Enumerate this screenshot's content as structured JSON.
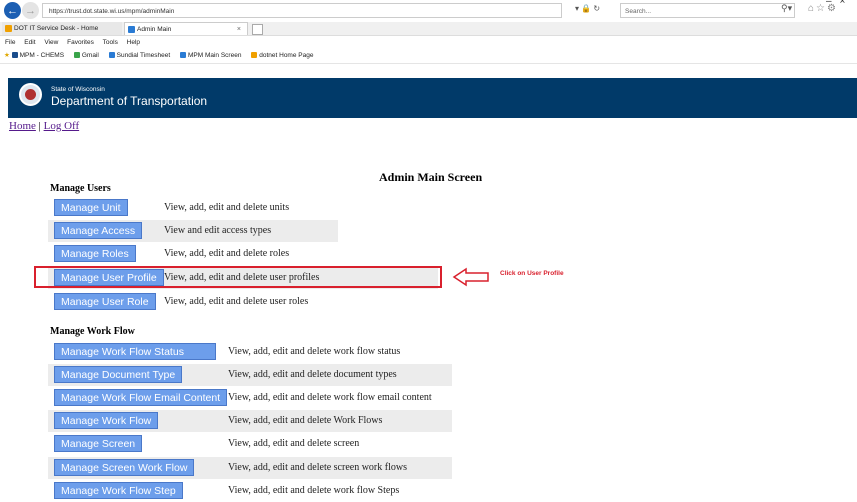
{
  "browser": {
    "url": "https://trust.dot.state.wi.us/mpm/adminMain",
    "search_placeholder": "Search...",
    "tabs": [
      {
        "label": "DOT IT Service Desk - Home"
      },
      {
        "label": "Admin Main"
      }
    ],
    "menu": [
      "File",
      "Edit",
      "View",
      "Favorites",
      "Tools",
      "Help"
    ],
    "favorites": [
      "MPM - CHEMS",
      "Gmail",
      "Sundial Timesheet",
      "MPM Main Screen",
      "dotnet Home Page"
    ]
  },
  "banner": {
    "line1": "State of Wisconsin",
    "line2": "Department of Transportation"
  },
  "nav": {
    "home": "Home",
    "separator": " | ",
    "logoff": "Log Off"
  },
  "page_title": "Admin Main Screen",
  "manage_users": {
    "heading": "Manage Users",
    "rows": [
      {
        "button": "Manage Unit",
        "desc": "View, add, edit and delete units"
      },
      {
        "button": "Manage Access",
        "desc": "View and edit access types"
      },
      {
        "button": "Manage Roles",
        "desc": "View, add, edit and delete roles"
      },
      {
        "button": "Manage User Profile",
        "desc": "View, add, edit and delete user profiles"
      },
      {
        "button": "Manage User Role",
        "desc": "View, add, edit and delete user roles"
      }
    ]
  },
  "manage_work_flow": {
    "heading": "Manage Work Flow",
    "rows": [
      {
        "button": "Manage Work Flow Status",
        "desc": "View, add, edit and delete work flow status"
      },
      {
        "button": "Manage Document Type",
        "desc": "View, add, edit and delete document types"
      },
      {
        "button": "Manage Work Flow Email Content",
        "desc": "View, add, edit and delete work flow email content"
      },
      {
        "button": "Manage Work Flow",
        "desc": "View, add, edit and delete Work Flows"
      },
      {
        "button": "Manage Screen",
        "desc": "View, add, edit and delete screen"
      },
      {
        "button": "Manage Screen Work Flow",
        "desc": "View, add, edit and delete screen work flows"
      },
      {
        "button": "Manage Work Flow Step",
        "desc": "View, add, edit and delete work flow Steps"
      }
    ]
  },
  "annotation": {
    "text": "Click on User Profile"
  },
  "colors": {
    "banner": "#013a69",
    "button": "#6d9eeb",
    "highlight": "#d9202d",
    "row_shade": "#ececec"
  }
}
